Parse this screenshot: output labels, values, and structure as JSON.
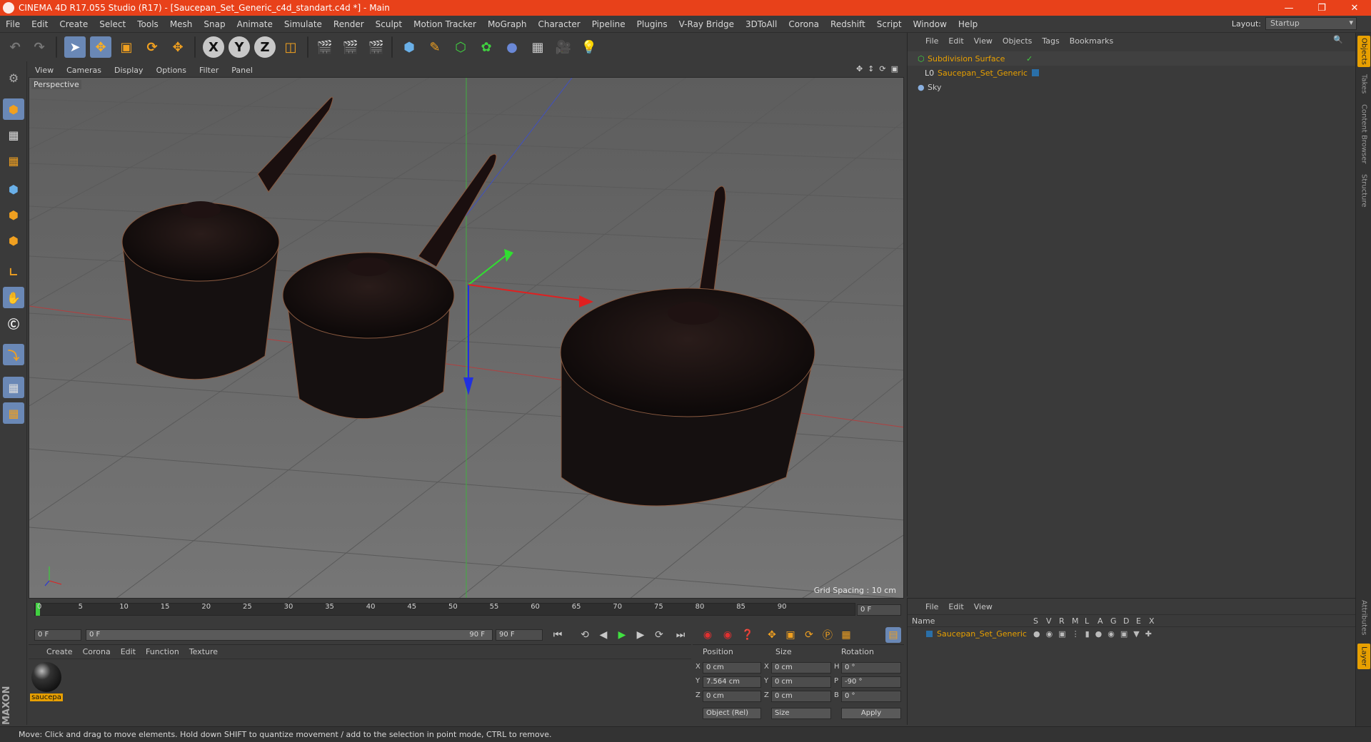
{
  "window": {
    "title": "CINEMA 4D R17.055 Studio (R17) - [Saucepan_Set_Generic_c4d_standart.c4d *] - Main",
    "min": "—",
    "max": "❐",
    "close": "✕"
  },
  "menu": [
    "File",
    "Edit",
    "Create",
    "Select",
    "Tools",
    "Mesh",
    "Snap",
    "Animate",
    "Simulate",
    "Render",
    "Sculpt",
    "Motion Tracker",
    "MoGraph",
    "Character",
    "Pipeline",
    "Plugins",
    "V-Ray Bridge",
    "3DToAll",
    "Corona",
    "Redshift",
    "Script",
    "Window",
    "Help"
  ],
  "layout": {
    "label": "Layout:",
    "value": "Startup"
  },
  "toolbar": {
    "x": "X",
    "y": "Y",
    "z": "Z"
  },
  "viewport": {
    "menu": [
      "View",
      "Cameras",
      "Display",
      "Options",
      "Filter",
      "Panel"
    ],
    "label": "Perspective",
    "grid_spacing": "Grid Spacing : 10 cm"
  },
  "timeline": {
    "ticks": [
      "0",
      "5",
      "10",
      "15",
      "20",
      "25",
      "30",
      "35",
      "40",
      "45",
      "50",
      "55",
      "60",
      "65",
      "70",
      "75",
      "80",
      "85",
      "90"
    ],
    "frame_end_field": "0 F",
    "start": "0 F",
    "range_start": "0 F",
    "range_end": "90 F",
    "end": "90 F"
  },
  "material_manager": {
    "menu": [
      "Create",
      "Corona",
      "Edit",
      "Function",
      "Texture"
    ],
    "material_name": "saucepa"
  },
  "coordinates": {
    "headers": [
      "Position",
      "Size",
      "Rotation"
    ],
    "rows": [
      {
        "axis": "X",
        "pos": "0 cm",
        "saxis": "X",
        "size": "0 cm",
        "raxis": "H",
        "rot": "0 °"
      },
      {
        "axis": "Y",
        "pos": "7.564 cm",
        "saxis": "Y",
        "size": "0 cm",
        "raxis": "P",
        "rot": "-90 °"
      },
      {
        "axis": "Z",
        "pos": "0 cm",
        "saxis": "Z",
        "size": "0 cm",
        "raxis": "B",
        "rot": "0 °"
      }
    ],
    "mode": "Object (Rel)",
    "size_mode": "Size",
    "apply": "Apply"
  },
  "object_manager": {
    "menu": [
      "File",
      "Edit",
      "View",
      "Objects",
      "Tags",
      "Bookmarks"
    ],
    "objects": [
      "Subdivision Surface",
      "Saucepan_Set_Generic",
      "Sky"
    ]
  },
  "layer_manager": {
    "menu": [
      "File",
      "Edit",
      "View"
    ],
    "col_name": "Name",
    "cols": [
      "S",
      "V",
      "R",
      "M",
      "L",
      "A",
      "G",
      "D",
      "E",
      "X"
    ],
    "layer": "Saucepan_Set_Generic"
  },
  "right_tabs": [
    "Objects",
    "Takes",
    "Content Browser",
    "Structure",
    "Attributes",
    "Layer"
  ],
  "status": "Move: Click and drag to move elements. Hold down SHIFT to quantize movement / add to the selection in point mode, CTRL to remove.",
  "brand": {
    "maxon": "MAXON",
    "c4d": "CINEMA 4D"
  }
}
